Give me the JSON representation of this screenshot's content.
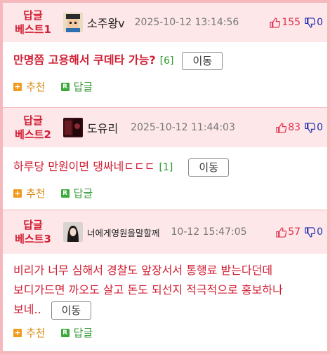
{
  "posts": [
    {
      "rank_line1": "답글",
      "rank_line2": "베스트1",
      "nickname": "소주왕v",
      "time": "2025-10-12 13:14:56",
      "up": "155",
      "down": "0",
      "content": "만명쯤 고용해서 쿠데타 가능?",
      "reply_count": "[6]",
      "move_label": "이동",
      "recommend_label": "추천",
      "reply_label": "답글"
    },
    {
      "rank_line1": "답글",
      "rank_line2": "베스트2",
      "nickname": "도유리",
      "time": "2025-10-12 11:44:03",
      "up": "83",
      "down": "0",
      "content": "하루당 만원이면 댕싸네ㄷㄷㄷ",
      "reply_count": "[1]",
      "move_label": "이동",
      "recommend_label": "추천",
      "reply_label": "답글"
    },
    {
      "rank_line1": "답글",
      "rank_line2": "베스트3",
      "nickname": "너에게영원을말할께",
      "time": "10-12 15:47:05",
      "up": "57",
      "down": "0",
      "content_line1": "비리가 너무 심해서 경찰도 앞장서서 통행료 받는다던데",
      "content_line2": "보디가드면 까오도 살고 돈도 되선지 적극적으로 홍보하나",
      "content_line3": "보네..",
      "move_label": "이동",
      "recommend_label": "추천",
      "reply_label": "답글"
    }
  ],
  "icons": {
    "recommend": "plus-square-icon",
    "reply": "reply-r-icon",
    "up": "thumb-up-icon",
    "down": "thumb-down-icon"
  },
  "colors": {
    "border": "#f5b8bd",
    "header_bg": "#fde7e9",
    "rank_red": "#d02035",
    "up_red": "#e0304a",
    "down_blue": "#1f2fb0",
    "count_green": "#2d9a2d",
    "recommend_orange": "#f19a1e",
    "reply_green": "#3aaa3a"
  }
}
